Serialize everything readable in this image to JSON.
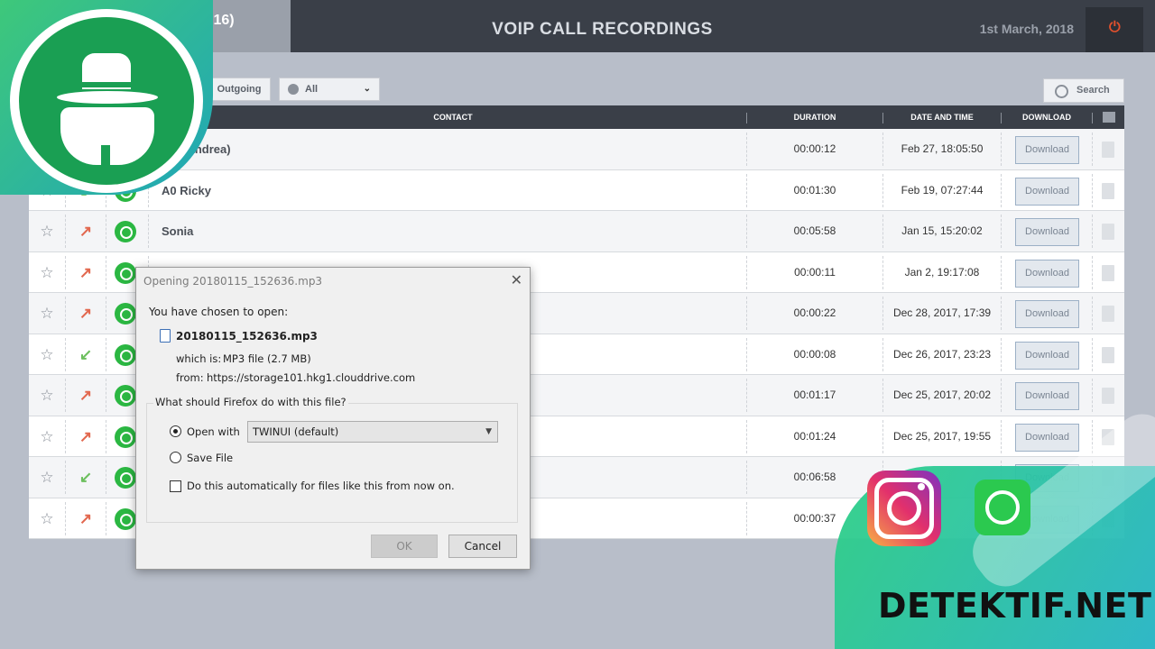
{
  "header": {
    "device_label": "5 (2016)",
    "title": "VOIP CALL RECORDINGS",
    "date": "1st March, 2018",
    "power_icon": "power-icon"
  },
  "filters": {
    "outgoing_label": "Outgoing",
    "app_filter_value": "All",
    "search_label": "Search"
  },
  "table": {
    "columns": [
      "CONTACT",
      "DURATION",
      "DATE AND TIME",
      "DOWNLOAD"
    ],
    "download_label": "Download",
    "rows": [
      {
        "direction": "out",
        "contact": "ella (andrea)",
        "duration": "00:00:12",
        "datetime": "Feb 27, 18:05:50"
      },
      {
        "direction": "in",
        "contact": "A0 Ricky",
        "duration": "00:01:30",
        "datetime": "Feb 19, 07:27:44"
      },
      {
        "direction": "out",
        "contact": "Sonia",
        "duration": "00:05:58",
        "datetime": "Jan 15, 15:20:02"
      },
      {
        "direction": "out",
        "contact": "",
        "duration": "00:00:11",
        "datetime": "Jan 2, 19:17:08"
      },
      {
        "direction": "out",
        "contact": "",
        "duration": "00:00:22",
        "datetime": "Dec 28, 2017, 17:39"
      },
      {
        "direction": "in",
        "contact": "",
        "duration": "00:00:08",
        "datetime": "Dec 26, 2017, 23:23"
      },
      {
        "direction": "out",
        "contact": "",
        "duration": "00:01:17",
        "datetime": "Dec 25, 2017, 20:02"
      },
      {
        "direction": "out",
        "contact": "",
        "duration": "00:01:24",
        "datetime": "Dec 25, 2017, 19:55"
      },
      {
        "direction": "in",
        "contact": "",
        "duration": "00:06:58",
        "datetime": ""
      },
      {
        "direction": "out",
        "contact": "",
        "duration": "00:00:37",
        "datetime": ""
      }
    ]
  },
  "dialog": {
    "title": "Opening 20180115_152636.mp3",
    "chosen_text": "You have chosen to open:",
    "file_name": "20180115_152636.mp3",
    "which_label": "which is:",
    "which_value": "MP3 file (2.7 MB)",
    "from_label": "from:",
    "from_value": "https://storage101.hkg1.clouddrive.com",
    "question": "What should Firefox do with this file?",
    "open_with_label": "Open with",
    "open_with_value": "TWINUI (default)",
    "save_file_label": "Save File",
    "auto_label": "Do this automatically for files like this from now on.",
    "ok_label": "OK",
    "cancel_label": "Cancel"
  },
  "branding": {
    "site": "DETEKTIF.NET"
  }
}
